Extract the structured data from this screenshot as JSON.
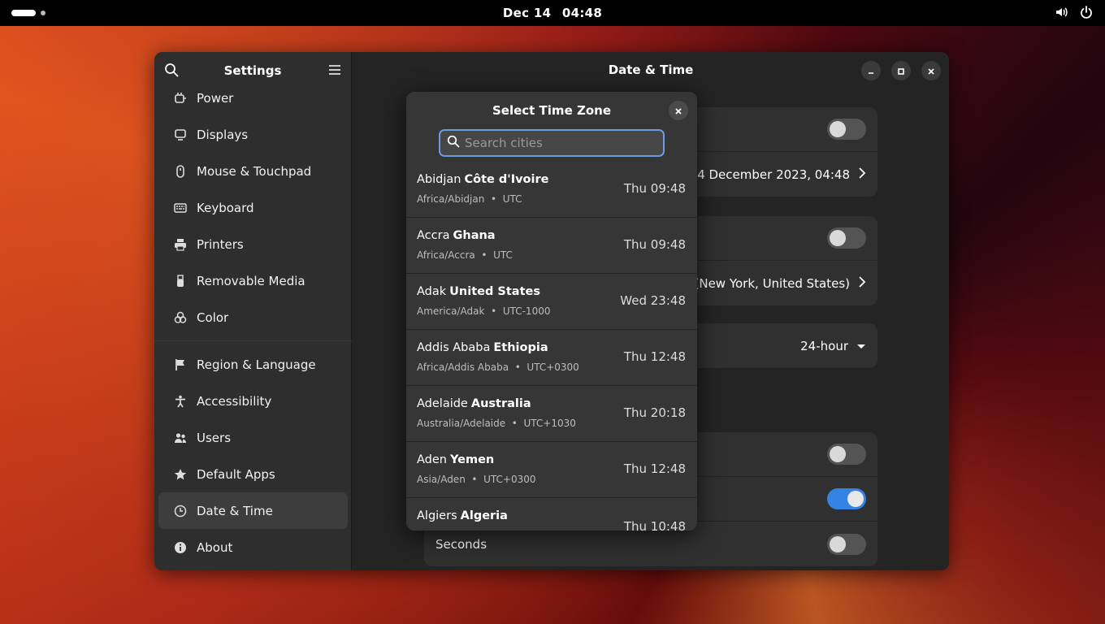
{
  "topbar": {
    "date": "Dec 14",
    "time": "04:48",
    "icons": [
      "activities-indicator",
      "volume-icon",
      "power-icon"
    ]
  },
  "window": {
    "sidebar": {
      "title": "Settings",
      "items": [
        {
          "label": "Power",
          "icon": "power-plug-icon"
        },
        {
          "label": "Displays",
          "icon": "display-icon"
        },
        {
          "label": "Mouse & Touchpad",
          "icon": "mouse-icon"
        },
        {
          "label": "Keyboard",
          "icon": "keyboard-icon"
        },
        {
          "label": "Printers",
          "icon": "printer-icon"
        },
        {
          "label": "Removable Media",
          "icon": "usb-icon"
        },
        {
          "label": "Color",
          "icon": "palette-icon"
        },
        {
          "label": "Region & Language",
          "icon": "flag-icon"
        },
        {
          "label": "Accessibility",
          "icon": "accessibility-icon"
        },
        {
          "label": "Users",
          "icon": "users-icon"
        },
        {
          "label": "Default Apps",
          "icon": "star-icon"
        },
        {
          "label": "Date & Time",
          "icon": "clock-icon",
          "active": true
        },
        {
          "label": "About",
          "icon": "info-icon"
        }
      ]
    },
    "content": {
      "title": "Date & Time",
      "datetime_value": "14 December 2023, 04:48",
      "timezone_value": "EST (New York, United States)",
      "time_format_value": "24-hour",
      "seconds_label": "Seconds"
    }
  },
  "dialog": {
    "title": "Select Time Zone",
    "search_placeholder": "Search cities",
    "zones": [
      {
        "city": "Abidjan",
        "country": "Côte d'Ivoire",
        "tz": "Africa/Abidjan",
        "offset": "UTC",
        "time": "Thu 09:48"
      },
      {
        "city": "Accra",
        "country": "Ghana",
        "tz": "Africa/Accra",
        "offset": "UTC",
        "time": "Thu 09:48"
      },
      {
        "city": "Adak",
        "country": "United States",
        "tz": "America/Adak",
        "offset": "UTC-1000",
        "time": "Wed 23:48"
      },
      {
        "city": "Addis Ababa",
        "country": "Ethiopia",
        "tz": "Africa/Addis Ababa",
        "offset": "UTC+0300",
        "time": "Thu 12:48"
      },
      {
        "city": "Adelaide",
        "country": "Australia",
        "tz": "Australia/Adelaide",
        "offset": "UTC+1030",
        "time": "Thu 20:18"
      },
      {
        "city": "Aden",
        "country": "Yemen",
        "tz": "Asia/Aden",
        "offset": "UTC+0300",
        "time": "Thu 12:48"
      },
      {
        "city": "Algiers",
        "country": "Algeria",
        "tz": "",
        "offset": "",
        "time": "Thu 10:48"
      }
    ]
  },
  "colors": {
    "accent": "#3584e4",
    "window_bg": "#242424",
    "sidebar_bg": "#2e2e2e",
    "dialog_bg": "#363636"
  }
}
